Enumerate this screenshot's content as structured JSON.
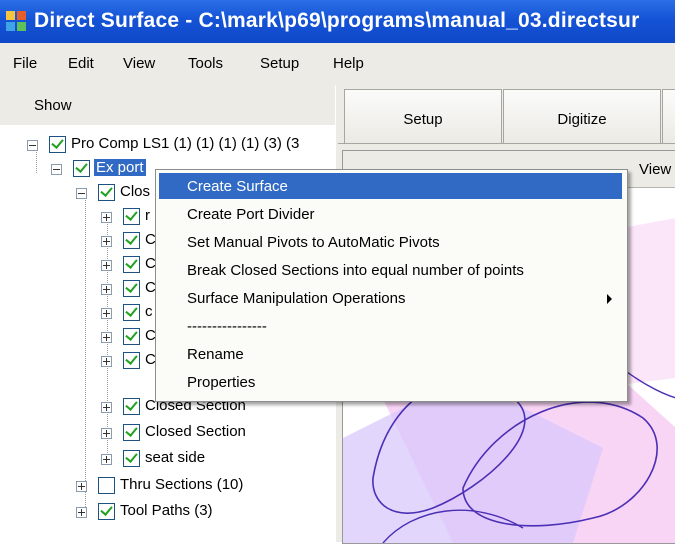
{
  "window": {
    "title": "Direct Surface - C:\\mark\\p69\\programs\\manual_03.directsur"
  },
  "menubar": {
    "items": [
      "File",
      "Edit",
      "View",
      "Tools",
      "Setup",
      "Help"
    ]
  },
  "left_panel": {
    "show_label": "Show"
  },
  "tree": {
    "root": "Pro Comp LS1 (1) (1) (1) (1) (3) (3",
    "ex_port": "Ex port",
    "closed_group": "Clos",
    "child_fragments": [
      "r",
      "C",
      "C",
      "C",
      "c",
      "C",
      "C"
    ],
    "closed_section_partial": "Closed Section",
    "closed_section": "Closed Section",
    "seat_side": "seat side",
    "thru_sections": "Thru Sections (10)",
    "tool_paths": "Tool Paths (3)"
  },
  "tabs": [
    "Setup",
    "Digitize"
  ],
  "viewport": {
    "view_label": "View"
  },
  "context_menu": {
    "items": [
      "Create Surface",
      "Create Port Divider",
      "Set Manual Pivots to AutoMatic Pivots",
      "Break Closed Sections into equal number of points",
      "Surface Manipulation Operations",
      "----------------",
      "Rename",
      "Properties"
    ]
  },
  "colors": {
    "title_bar": "#1553d6",
    "selection": "#316ac5",
    "checkmark": "#21a121",
    "menu_bg": "#ecebe6"
  }
}
